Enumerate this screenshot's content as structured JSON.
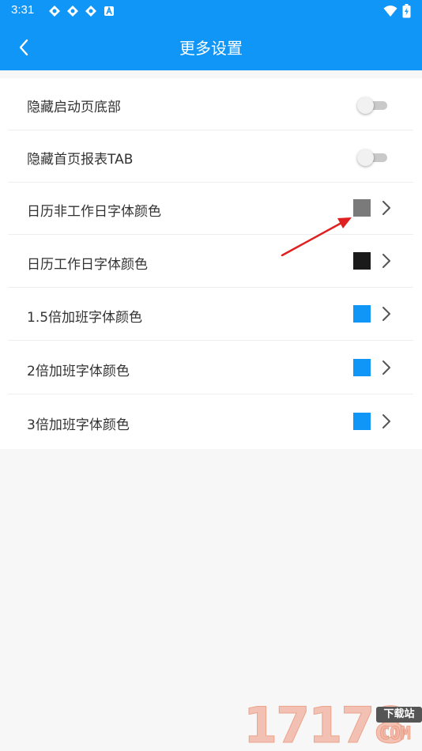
{
  "status_bar": {
    "time": "3:31",
    "left_icons": [
      "app-notification-icon",
      "app-notification-icon",
      "app-notification-icon",
      "a-notification-icon"
    ],
    "right_icons": [
      "wifi-icon",
      "battery-charging-icon"
    ]
  },
  "header": {
    "title": "更多设置",
    "back_icon": "chevron-left-icon",
    "background": "#1096f6"
  },
  "settings": {
    "toggles": [
      {
        "label": "隐藏启动页底部",
        "on": false
      },
      {
        "label": "隐藏首页报表TAB",
        "on": false
      }
    ],
    "colors": [
      {
        "label": "日历非工作日字体颜色",
        "color": "#7a7a7a"
      },
      {
        "label": "日历工作日字体颜色",
        "color": "#1a1a1a"
      },
      {
        "label": "1.5倍加班字体颜色",
        "color": "#1096f6"
      },
      {
        "label": "2倍加班字体颜色",
        "color": "#1096f6"
      },
      {
        "label": "3倍加班字体颜色",
        "color": "#1096f6"
      }
    ]
  },
  "annotation": {
    "color": "#e02020"
  },
  "watermark": {
    "digits": "17178",
    "badge": "下载站",
    "suffix": "COM"
  }
}
